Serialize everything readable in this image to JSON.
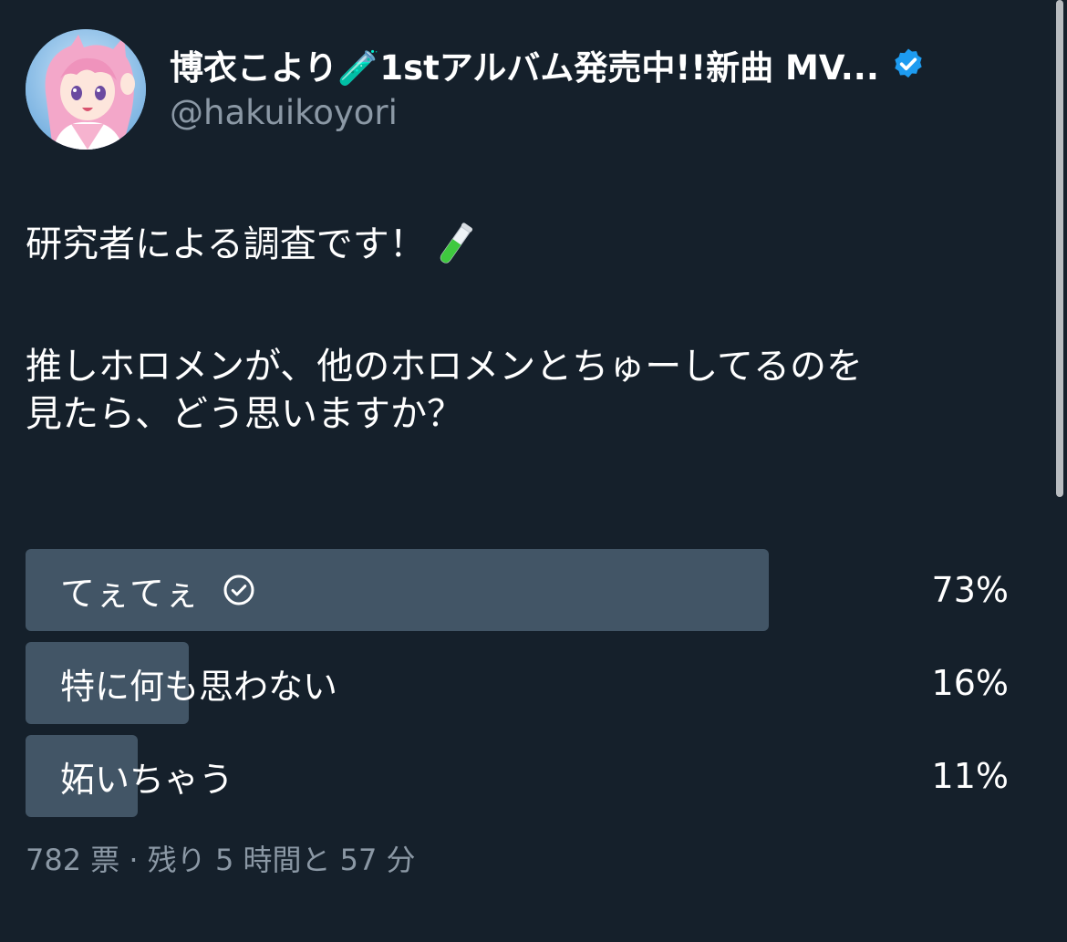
{
  "author": {
    "display_name": "博衣こより🧪1stアルバム発売中!!新曲 MV...",
    "handle": "@hakuikoyori",
    "verified": true
  },
  "tweet": {
    "line1": "研究者による調査です！",
    "line2": "推しホロメンが、他のホロメンとちゅーしてるのを",
    "line3": "見たら、どう思いますか？"
  },
  "poll": {
    "options": [
      {
        "label": "てぇてぇ",
        "percent_text": "73%",
        "percent": 73,
        "selected": true
      },
      {
        "label": "特に何も思わない",
        "percent_text": "16%",
        "percent": 16,
        "selected": false
      },
      {
        "label": "妬いちゃう",
        "percent_text": "11%",
        "percent": 11,
        "selected": false
      }
    ],
    "meta": "782 票 · 残り 5 時間と 57 分"
  },
  "icons": {
    "verified": "verified-badge-icon",
    "check": "check-circle-icon",
    "test_tube": "test-tube-icon"
  },
  "colors": {
    "background": "#15202b",
    "bar": "#425566",
    "secondary_text": "#8b98a5",
    "verified": "#1d9bf0",
    "test_tube_liquid": "#3fc93f"
  }
}
